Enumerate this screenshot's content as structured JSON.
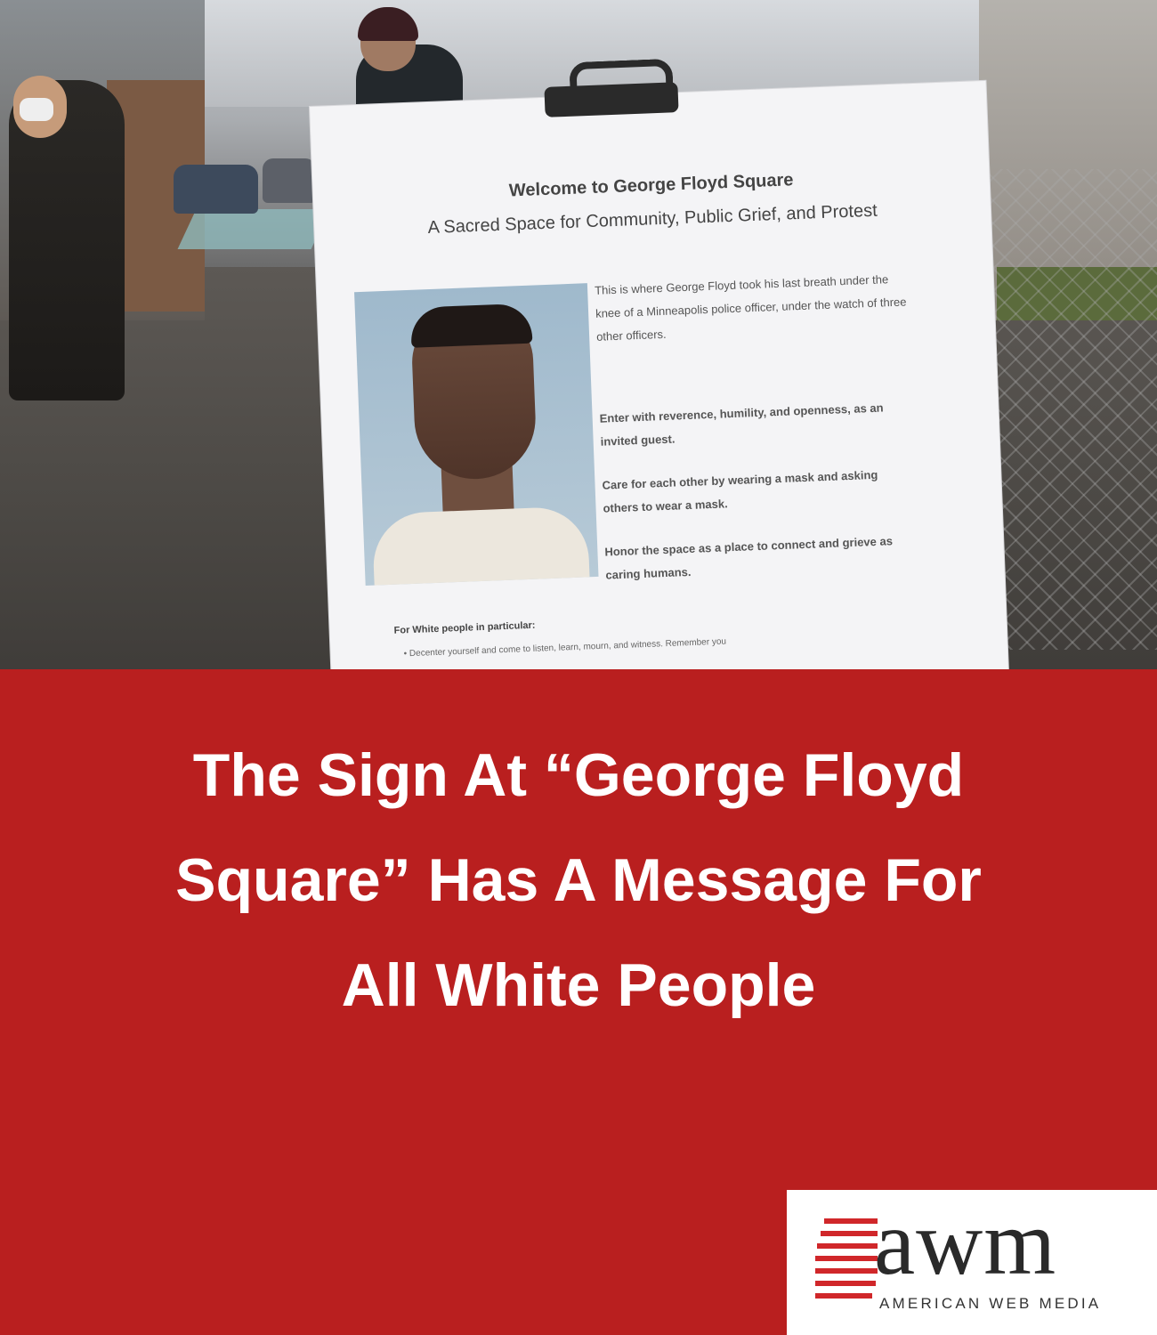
{
  "photo": {
    "sign": {
      "title": "Welcome to George Floyd Square",
      "subtitle": "A Sacred Space for Community, Public Grief, and Protest",
      "paragraphs": [
        "This is where George Floyd took his last breath under the knee of a Minneapolis police officer, under the watch of three other officers.",
        "Enter with reverence, humility, and openness, as an invited guest.",
        "Care for each other by wearing a mask and asking others to wear a mask.",
        "Honor the space as a place to connect and grieve as caring humans."
      ],
      "section_heading": "For White people in particular:",
      "bullet": "• Decenter yourself and come to listen, learn, mourn, and witness. Remember you"
    }
  },
  "headline": "The Sign At “George Floyd Square” Has A Message For All White People",
  "logo": {
    "mark": "awm",
    "subtitle": "AMERICAN WEB MEDIA"
  },
  "colors": {
    "background": "#b91f1f",
    "headline_text": "#ffffff",
    "logo_accent": "#d0272a"
  }
}
